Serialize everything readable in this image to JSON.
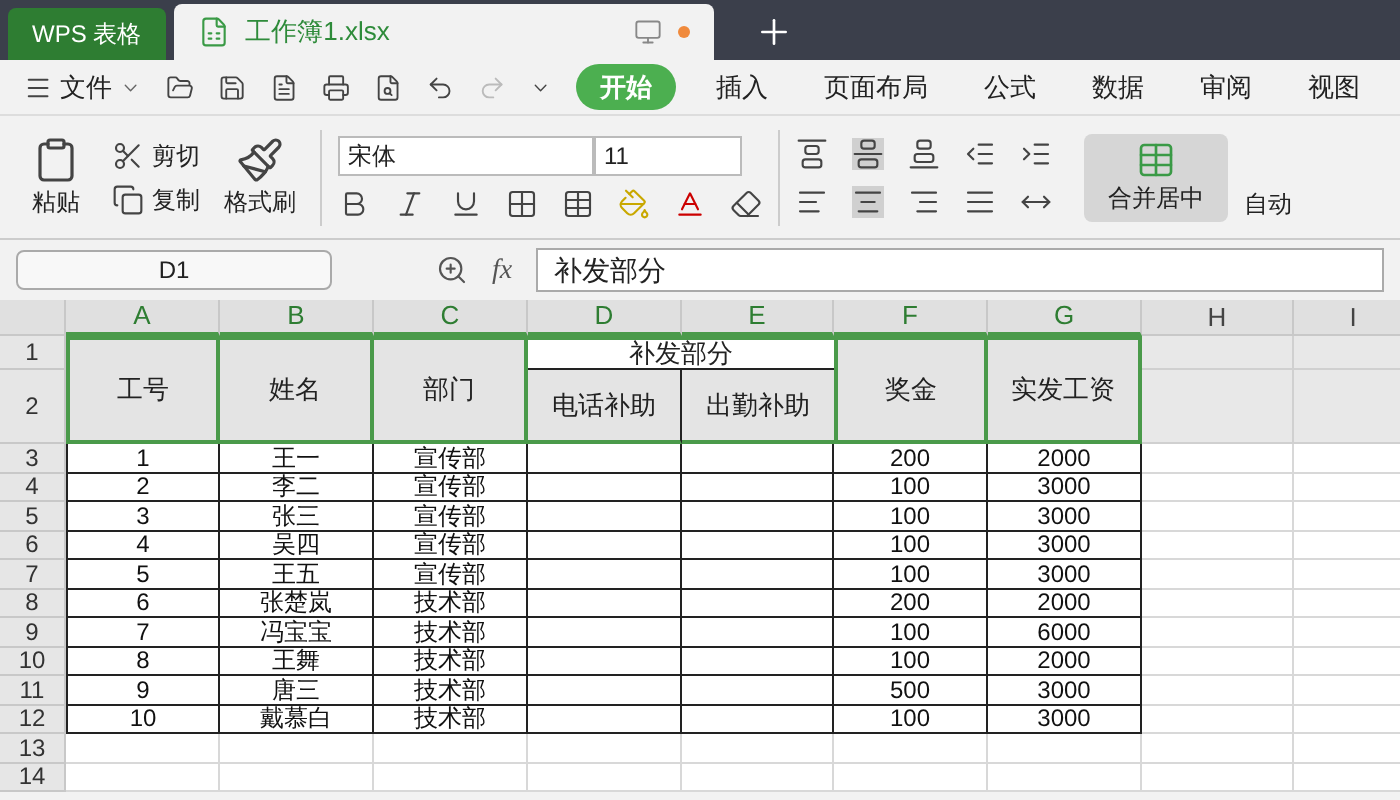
{
  "app_tab": {
    "label": "WPS 表格"
  },
  "doc_tab": {
    "label": "工作簿1.xlsx",
    "selected": true
  },
  "menu": {
    "file": "文件",
    "tabs": [
      {
        "label": "开始",
        "selected": true
      },
      {
        "label": "插入",
        "selected": false
      },
      {
        "label": "页面布局",
        "selected": false
      },
      {
        "label": "公式",
        "selected": false
      },
      {
        "label": "数据",
        "selected": false
      },
      {
        "label": "审阅",
        "selected": false
      },
      {
        "label": "视图",
        "selected": false
      }
    ]
  },
  "toolbar": {
    "paste": "粘贴",
    "cut": "剪切",
    "copy": "复制",
    "format_painter": "格式刷",
    "font": "宋体",
    "font_size": "11",
    "merge": "合并居中",
    "auto": "自动"
  },
  "formula_bar": {
    "cell": "D1",
    "fx": "fx",
    "value": "补发部分"
  },
  "sheet": {
    "columns": [
      "A",
      "B",
      "C",
      "D",
      "E",
      "F",
      "G",
      "H",
      "I"
    ],
    "header": {
      "no": "工号",
      "name": "姓名",
      "dept": "部门",
      "group": "补发部分",
      "phone": "电话补助",
      "attend": "出勤补助",
      "bonus": "奖金",
      "pay": "实发工资"
    },
    "rows": [
      {
        "row": "3",
        "no": "1",
        "name": "王一",
        "dept": "宣传部",
        "bonus": "200",
        "pay": "2000"
      },
      {
        "row": "4",
        "no": "2",
        "name": "李二",
        "dept": "宣传部",
        "bonus": "100",
        "pay": "3000"
      },
      {
        "row": "5",
        "no": "3",
        "name": "张三",
        "dept": "宣传部",
        "bonus": "100",
        "pay": "3000"
      },
      {
        "row": "6",
        "no": "4",
        "name": "吴四",
        "dept": "宣传部",
        "bonus": "100",
        "pay": "3000"
      },
      {
        "row": "7",
        "no": "5",
        "name": "王五",
        "dept": "宣传部",
        "bonus": "100",
        "pay": "3000"
      },
      {
        "row": "8",
        "no": "6",
        "name": "张楚岚",
        "dept": "技术部",
        "bonus": "200",
        "pay": "2000"
      },
      {
        "row": "9",
        "no": "7",
        "name": "冯宝宝",
        "dept": "技术部",
        "bonus": "100",
        "pay": "6000"
      },
      {
        "row": "10",
        "no": "8",
        "name": "王舞",
        "dept": "技术部",
        "bonus": "100",
        "pay": "2000"
      },
      {
        "row": "11",
        "no": "9",
        "name": "唐三",
        "dept": "技术部",
        "bonus": "500",
        "pay": "3000"
      },
      {
        "row": "12",
        "no": "10",
        "name": "戴慕白",
        "dept": "技术部",
        "bonus": "100",
        "pay": "3000"
      }
    ],
    "header_rows": [
      "1",
      "2"
    ],
    "empty_rows": [
      "13",
      "14"
    ]
  }
}
